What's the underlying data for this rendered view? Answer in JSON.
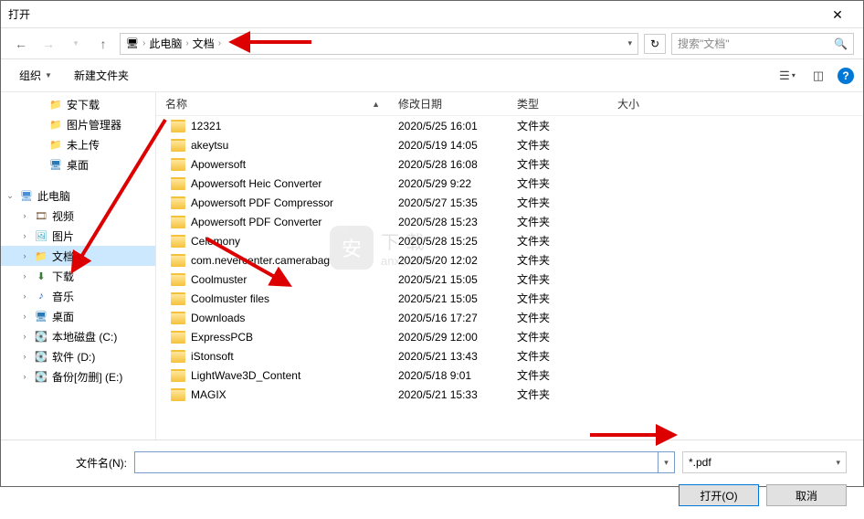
{
  "window": {
    "title": "打开"
  },
  "nav": {
    "breadcrumb_root": "此电脑",
    "breadcrumb_cur": "文档",
    "search_placeholder": "搜索\"文档\""
  },
  "toolbar": {
    "organize": "组织",
    "newfolder": "新建文件夹"
  },
  "columns": {
    "name": "名称",
    "date": "修改日期",
    "type": "类型",
    "size": "大小"
  },
  "sidebar": {
    "items": [
      {
        "label": "安下载",
        "icon": "folder-ico",
        "indent": 36
      },
      {
        "label": "图片管理器",
        "icon": "folder-ico",
        "indent": 36
      },
      {
        "label": "未上传",
        "icon": "folder-ico",
        "indent": 36
      },
      {
        "label": "桌面",
        "icon": "desk-ico",
        "indent": 36
      },
      {
        "label": "",
        "spacer": true
      },
      {
        "label": "此电脑",
        "icon": "pc-ico",
        "indent": 4,
        "chev": "down"
      },
      {
        "label": "视频",
        "icon": "video-ico",
        "indent": 20,
        "chev": "right"
      },
      {
        "label": "图片",
        "icon": "pic-ico",
        "indent": 20,
        "chev": "right"
      },
      {
        "label": "文档",
        "icon": "folder-ico",
        "indent": 20,
        "chev": "right",
        "selected": true
      },
      {
        "label": "下载",
        "icon": "down-ico",
        "indent": 20,
        "chev": "right"
      },
      {
        "label": "音乐",
        "icon": "music-ico",
        "indent": 20,
        "chev": "right"
      },
      {
        "label": "桌面",
        "icon": "desk-ico",
        "indent": 20,
        "chev": "right"
      },
      {
        "label": "本地磁盘 (C:)",
        "icon": "drive-ico",
        "indent": 20,
        "chev": "right"
      },
      {
        "label": "软件 (D:)",
        "icon": "drive-ico",
        "indent": 20,
        "chev": "right"
      },
      {
        "label": "备份[勿删] (E:)",
        "icon": "drive-ico",
        "indent": 20,
        "chev": "right"
      }
    ]
  },
  "files": [
    {
      "name": "12321",
      "date": "2020/5/25 16:01",
      "type": "文件夹"
    },
    {
      "name": "akeytsu",
      "date": "2020/5/19 14:05",
      "type": "文件夹"
    },
    {
      "name": "Apowersoft",
      "date": "2020/5/28 16:08",
      "type": "文件夹"
    },
    {
      "name": "Apowersoft Heic Converter",
      "date": "2020/5/29 9:22",
      "type": "文件夹"
    },
    {
      "name": "Apowersoft PDF Compressor",
      "date": "2020/5/27 15:35",
      "type": "文件夹"
    },
    {
      "name": "Apowersoft PDF Converter",
      "date": "2020/5/28 15:23",
      "type": "文件夹"
    },
    {
      "name": "Celemony",
      "date": "2020/5/28 15:25",
      "type": "文件夹"
    },
    {
      "name": "com.nevercenter.camerabag",
      "date": "2020/5/20 12:02",
      "type": "文件夹"
    },
    {
      "name": "Coolmuster",
      "date": "2020/5/21 15:05",
      "type": "文件夹"
    },
    {
      "name": "Coolmuster files",
      "date": "2020/5/21 15:05",
      "type": "文件夹"
    },
    {
      "name": "Downloads",
      "date": "2020/5/16 17:27",
      "type": "文件夹"
    },
    {
      "name": "ExpressPCB",
      "date": "2020/5/29 12:00",
      "type": "文件夹"
    },
    {
      "name": "iStonsoft",
      "date": "2020/5/21 13:43",
      "type": "文件夹"
    },
    {
      "name": "LightWave3D_Content",
      "date": "2020/5/18 9:01",
      "type": "文件夹"
    },
    {
      "name": "MAGIX",
      "date": "2020/5/21 15:33",
      "type": "文件夹"
    }
  ],
  "footer": {
    "filename_label": "文件名(N):",
    "filter": "*.pdf",
    "open": "打开(O)",
    "cancel": "取消"
  },
  "watermark": {
    "site": "anxz.com"
  }
}
